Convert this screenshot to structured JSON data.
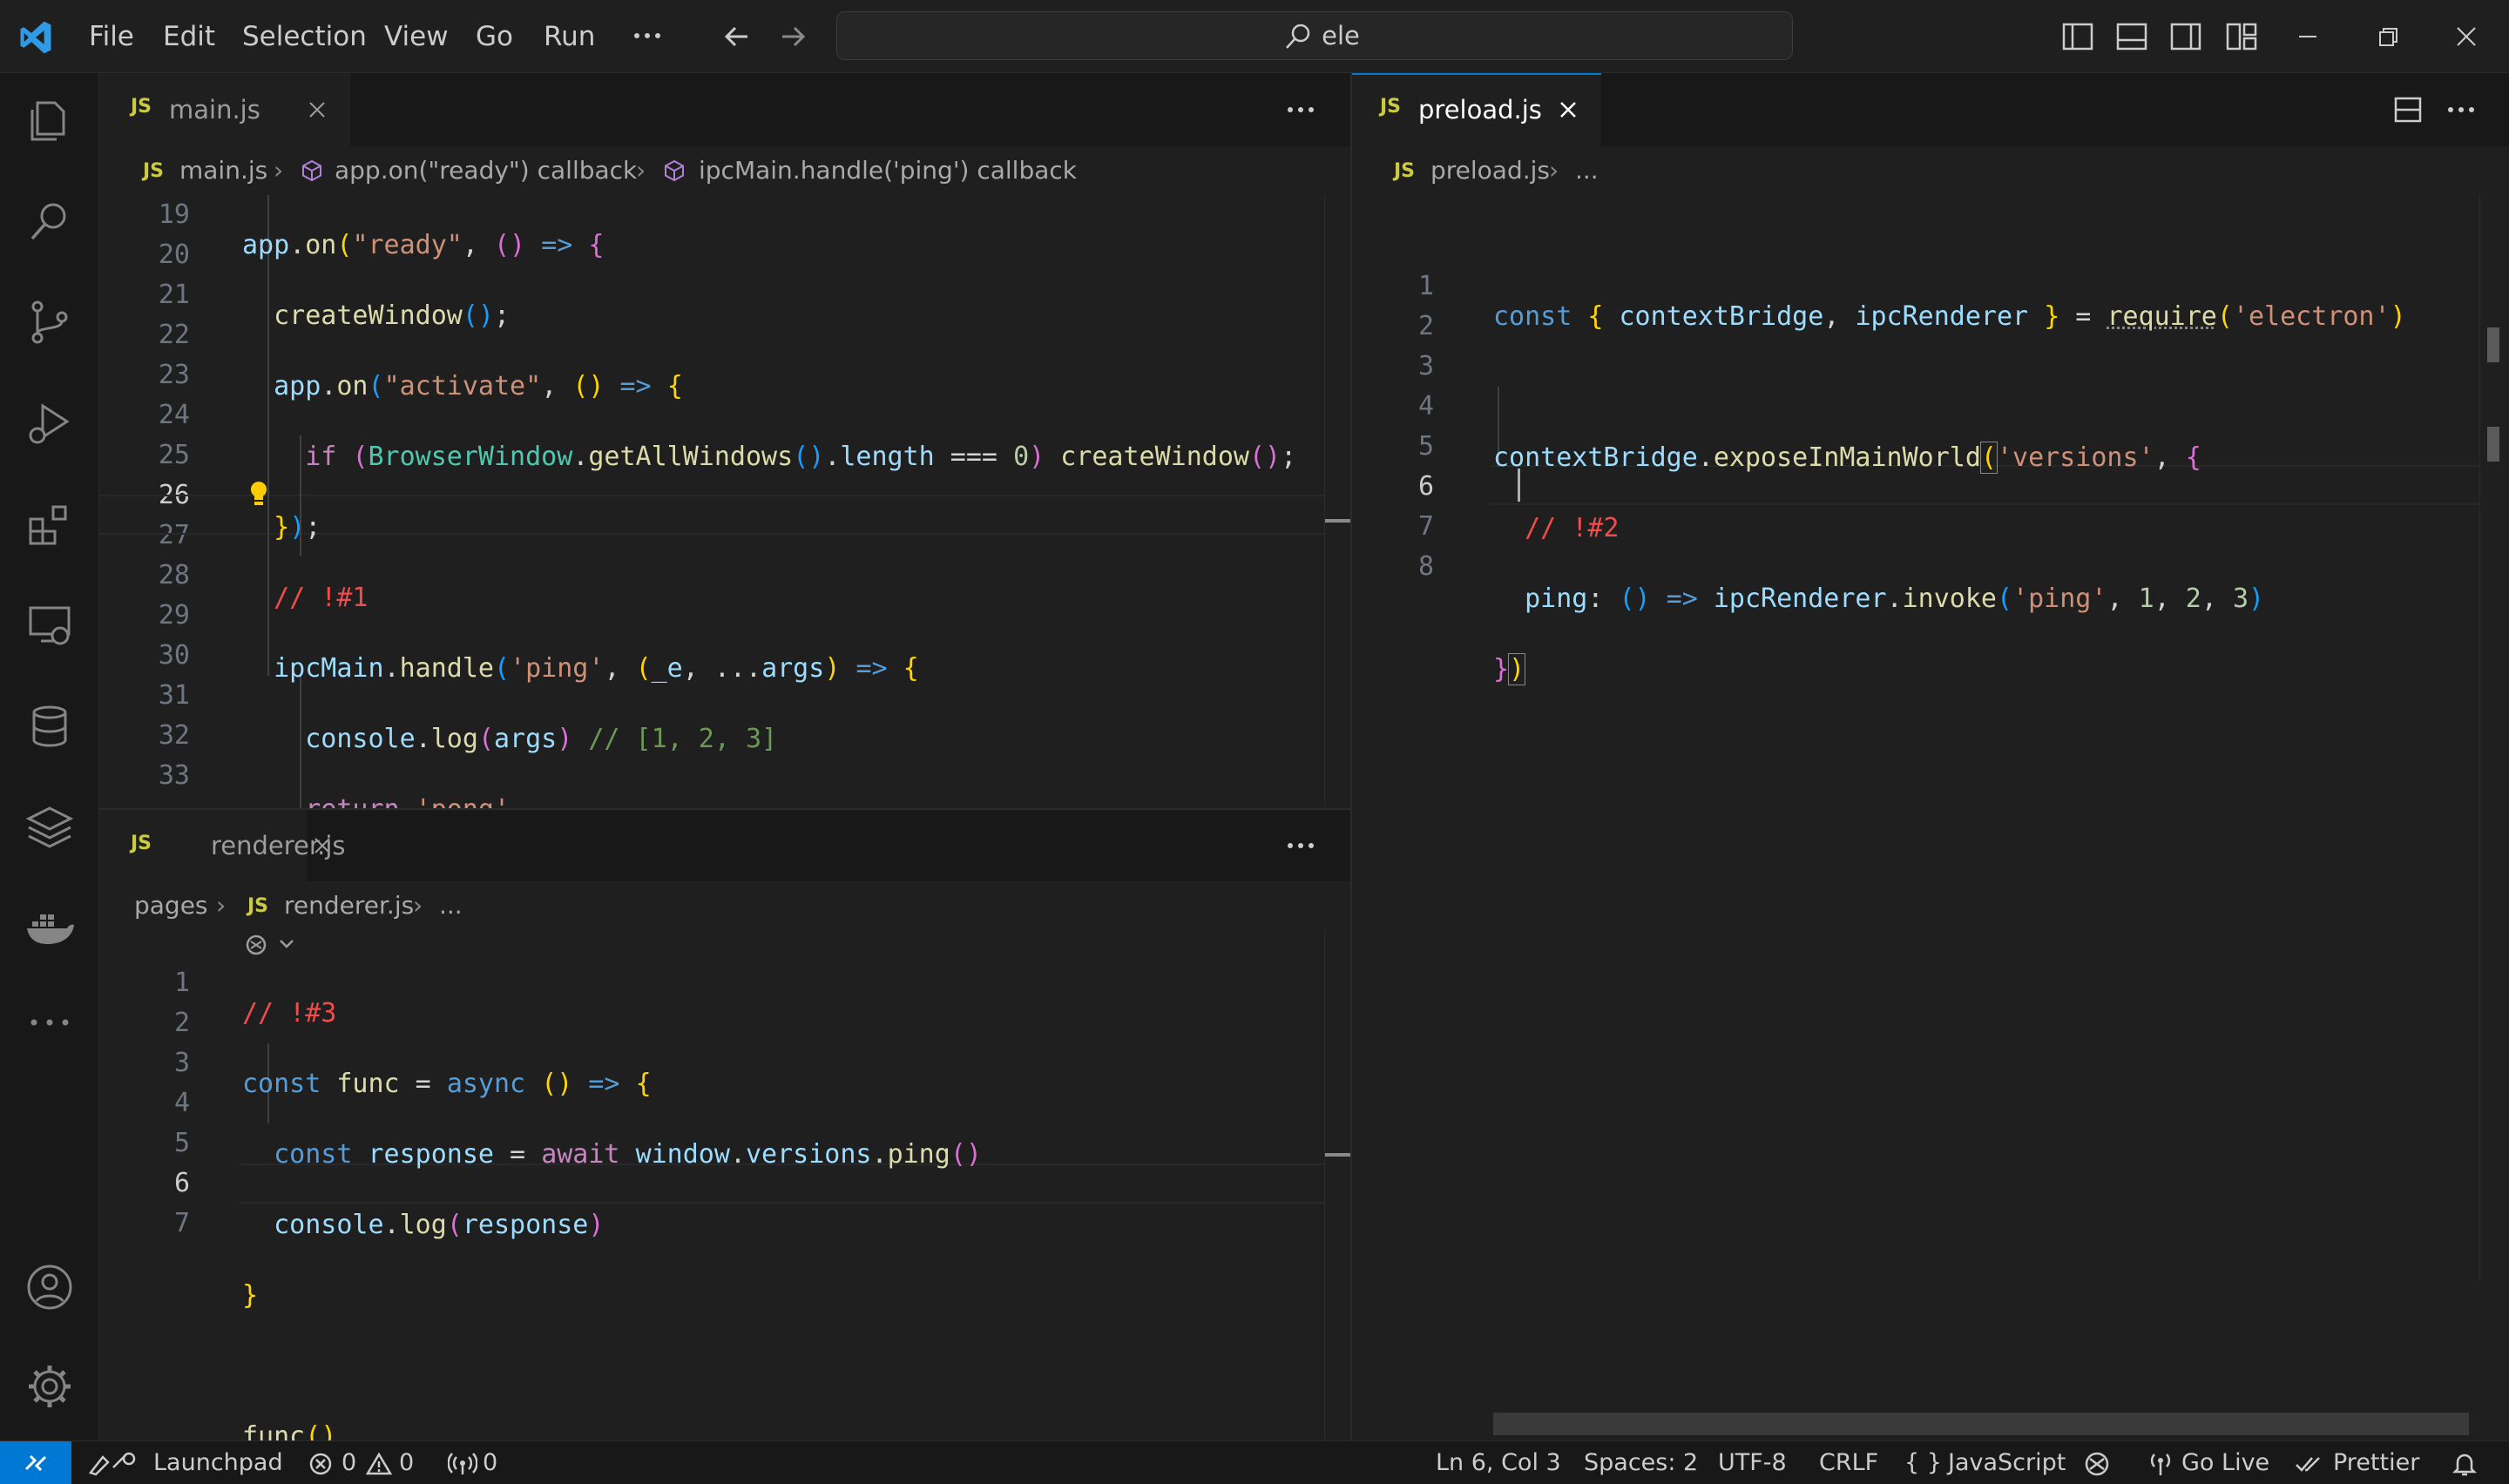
{
  "menu": [
    "File",
    "Edit",
    "Selection",
    "View",
    "Go",
    "Run"
  ],
  "search": {
    "value": "ele"
  },
  "editor_left_top": {
    "tab": {
      "label": "main.js",
      "lang": "JS"
    },
    "breadcrumb": [
      "main.js",
      "app.on(\"ready\") callback",
      "ipcMain.handle('ping') callback"
    ],
    "lines": [
      "19",
      "20",
      "21",
      "22",
      "23",
      "24",
      "25",
      "26",
      "27",
      "28",
      "29",
      "30",
      "31",
      "32",
      "33"
    ],
    "active_line": "26"
  },
  "editor_left_bottom": {
    "tab": {
      "label": "renderer.js",
      "lang": "JS"
    },
    "breadcrumb": [
      "pages",
      "renderer.js",
      "..."
    ],
    "lines": [
      "1",
      "2",
      "3",
      "4",
      "5",
      "6",
      "7"
    ],
    "active_line": "6"
  },
  "editor_right": {
    "tab": {
      "label": "preload.js",
      "lang": "JS"
    },
    "breadcrumb": [
      "preload.js",
      "..."
    ],
    "lines": [
      "1",
      "2",
      "3",
      "4",
      "5",
      "6",
      "7",
      "8"
    ],
    "active_line": "6"
  },
  "statusbar": {
    "launchpad": "Launchpad",
    "errors": "0",
    "warnings": "0",
    "ports": "0",
    "position": "Ln 6, Col 3",
    "spaces": "Spaces: 2",
    "encoding": "UTF-8",
    "eol": "CRLF",
    "language": "JavaScript",
    "golive": "Go Live",
    "prettier": "Prettier"
  },
  "colors": {
    "accent": "#0078d4",
    "background": "#1f1f1f",
    "sidebar": "#181818"
  }
}
